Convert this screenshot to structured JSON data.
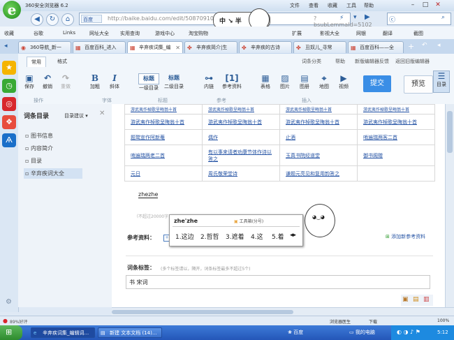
{
  "window": {
    "app_title": "360安全浏览器 6.2",
    "menu": [
      "文件",
      "查看",
      "收藏",
      "工具",
      "帮助"
    ]
  },
  "navbar": {
    "engine_label": "百度",
    "url": "http://baike.baidu.com/edit/50870910",
    "url_suffix": "?bsubLemmaId=5102",
    "search_placeholder": ""
  },
  "bookmarks": {
    "left": [
      "收藏",
      "谷歌",
      "Links",
      "网址大全",
      "实用查询",
      "游戏中心",
      "淘宝购物"
    ],
    "right": [
      "扩展",
      "影视大全",
      "网银",
      "翻译",
      "截图"
    ]
  },
  "tabs": [
    {
      "label": "360导航_新一",
      "active": false
    },
    {
      "label": "百度百科_进入",
      "active": false
    },
    {
      "label": "辛弃疾词集_编",
      "active": true
    },
    {
      "label": "辛弃疾简介|生",
      "active": false
    },
    {
      "label": "辛弃疾的古诗",
      "active": false
    },
    {
      "label": "丑奴儿_寻常",
      "active": false
    },
    {
      "label": "百度百科——全",
      "active": false
    }
  ],
  "ribbon": {
    "tabs": [
      "常用",
      "格式"
    ],
    "right_links": [
      "词条分类",
      "帮助",
      "新版编辑器反馈",
      "返回旧版编辑器"
    ],
    "buttons": [
      {
        "label": "保存"
      },
      {
        "label": "撤销"
      },
      {
        "label": "重做"
      },
      {
        "label": "加粗"
      },
      {
        "label": "斜体"
      },
      {
        "label": "一级目录"
      },
      {
        "label": "二级目录"
      },
      {
        "label": "内链"
      },
      {
        "label": "参考资料"
      },
      {
        "label": "表格"
      },
      {
        "label": "图片"
      },
      {
        "label": "图册"
      },
      {
        "label": "地图"
      },
      {
        "label": "视频"
      },
      {
        "label": "目录"
      }
    ],
    "icon_texts": {
      "heading1": "标题",
      "heading2": "标题",
      "ref": "[1]"
    },
    "groups": [
      "操作",
      "字体",
      "标题",
      "参考",
      "插入"
    ],
    "submit": "提交",
    "preview": "预览"
  },
  "toc": {
    "title": "词条目录",
    "suggest": "目录建议",
    "items": [
      "图书信息",
      "内容简介",
      "目录",
      "辛弃疾词大全"
    ]
  },
  "table": {
    "rows": [
      [
        "游武夷作棹歌呈晦翁十首",
        "游武夷作棹歌呈晦翁十首",
        "游武夷作棹歌呈晦翁十首",
        "游武夷作棹歌呈晦翁十首"
      ],
      [
        "游武夷作棹歌呈晦翁十首",
        "游武夷作棹歌呈晦翁十首",
        "游武夷作棹歌呈晦翁十首",
        "游武夷作棹歌呈晦翁十首"
      ],
      [
        "题鹫宣作阿新菴",
        "偶作",
        "止酒",
        "哨遍瑞两客二首"
      ],
      [
        "哨遍瑞两老二首",
        "有以事来请者劝康节体作诗以答之",
        "玉真书院经道堂",
        "御书阁赠"
      ],
      [
        "元日",
        "周氏敬荣堂诗",
        "谦题元亮见和复用韵答之",
        ""
      ]
    ]
  },
  "editor": {
    "typing": "zhezhe",
    "limit_hint": "（不超过20000字",
    "ref_label": "参考资料：",
    "add_ref": "添加新参考资料",
    "tags_label": "词条标签：",
    "tags_hint": "(多个标签请以，隔开，词条标签最多不超过5个)",
    "tags_value": "书 宋词"
  },
  "ime": {
    "input": "zhe'zhe",
    "mode": "工具箱(分号)",
    "candidates": [
      "1.这边",
      "2.哲哲",
      "3.遮着",
      "4.这",
      "5.着"
    ]
  },
  "statusbar": {
    "left": "89%好评",
    "items": [
      "浏览器医生",
      "下载",
      "100%"
    ]
  },
  "taskbar": {
    "tasks": [
      "辛弃疾词集_编辑词...",
      "新建 文本文档 (14)..."
    ],
    "quicklaunch": "百度",
    "mycomputer": "我的电脑",
    "clock": "5:12"
  },
  "colors": {
    "accent": "#3a8ee6",
    "taskbar": "#2a5fc0",
    "link": "#2553a4"
  }
}
